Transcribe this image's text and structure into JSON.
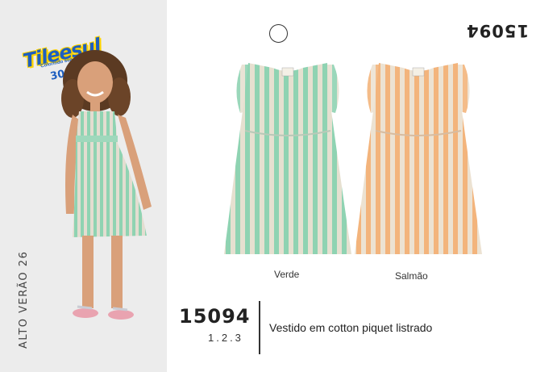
{
  "brand": {
    "logo_text": "Tileesul",
    "tagline": "Colorindo sua vida",
    "years": "30 anos"
  },
  "season": "ALTO VERÃO 26",
  "flipped_code": "15094",
  "product": {
    "code": "15094",
    "sizes": "1.2.3",
    "description": "Vestido em cotton piquet listrado"
  },
  "colors": [
    {
      "name": "Verde",
      "stripe": "#8fd3b2",
      "base": "#e6e0d0"
    },
    {
      "name": "Salmão",
      "stripe": "#f3b47c",
      "base": "#ece2d2"
    }
  ],
  "palette": {
    "panel_bg": "#ececec",
    "logo_blue": "#1e5fc0",
    "logo_yellow": "#ffd400"
  }
}
